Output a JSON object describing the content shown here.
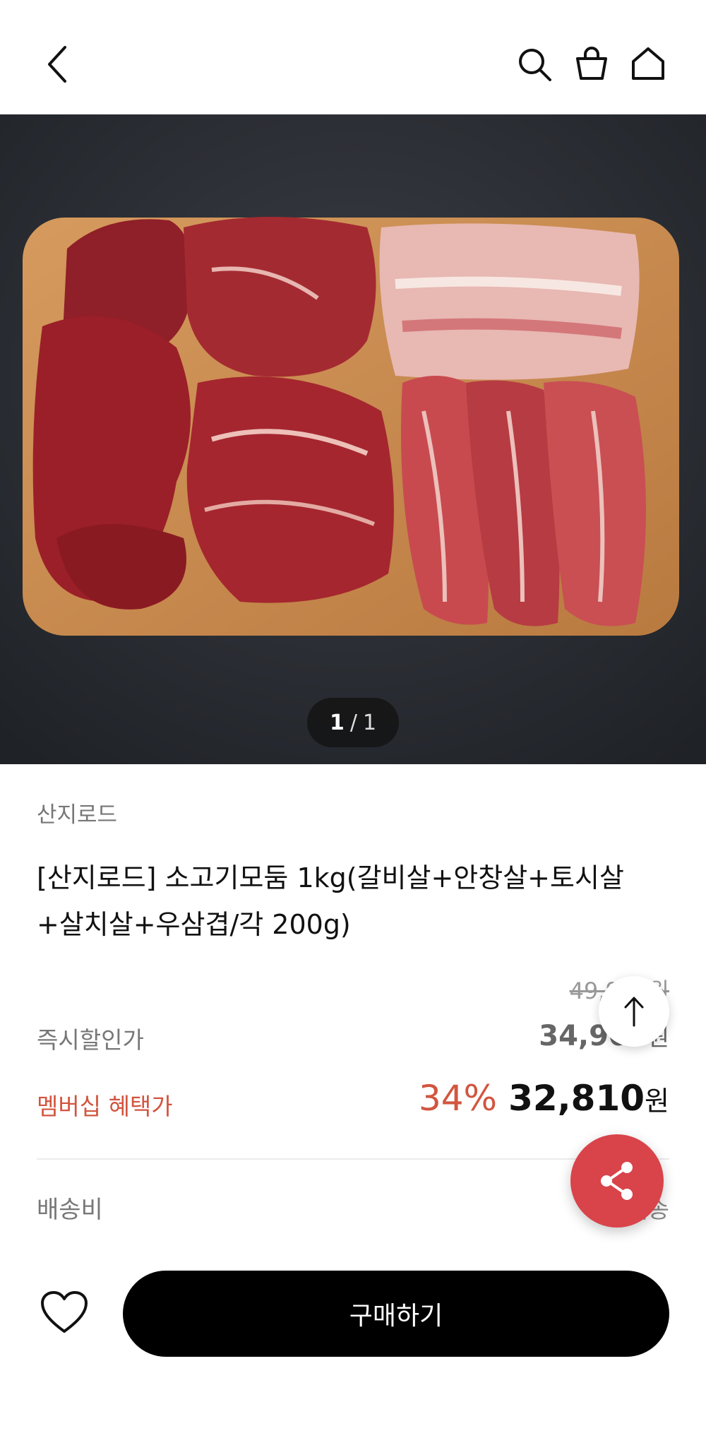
{
  "header": {
    "back_icon": "chevron-left-icon",
    "search_icon": "search-icon",
    "cart_icon": "shopping-bag-icon",
    "home_icon": "home-icon"
  },
  "gallery": {
    "current": "1",
    "separator": "/",
    "total": "1"
  },
  "product": {
    "brand": "산지로드",
    "title": "[산지로드] 소고기모둠 1kg(갈비살+안창살+토시살+살치살+우삼겹/각 200g)"
  },
  "pricing": {
    "original_price": "49,900원",
    "instant_label": "즉시할인가",
    "instant_price": "34,900",
    "instant_won": "원",
    "member_label": "멤버십 혜택가",
    "discount": "34%",
    "member_price": "32,810",
    "member_won": "원",
    "accent_color": "#d2553f"
  },
  "shipping": {
    "label": "배송비",
    "value": "무료배송"
  },
  "actions": {
    "buy_label": "구매하기",
    "wishlist_icon": "heart-icon",
    "scroll_top_icon": "arrow-up-icon",
    "share_icon": "share-icon",
    "share_color": "#d9434a"
  }
}
